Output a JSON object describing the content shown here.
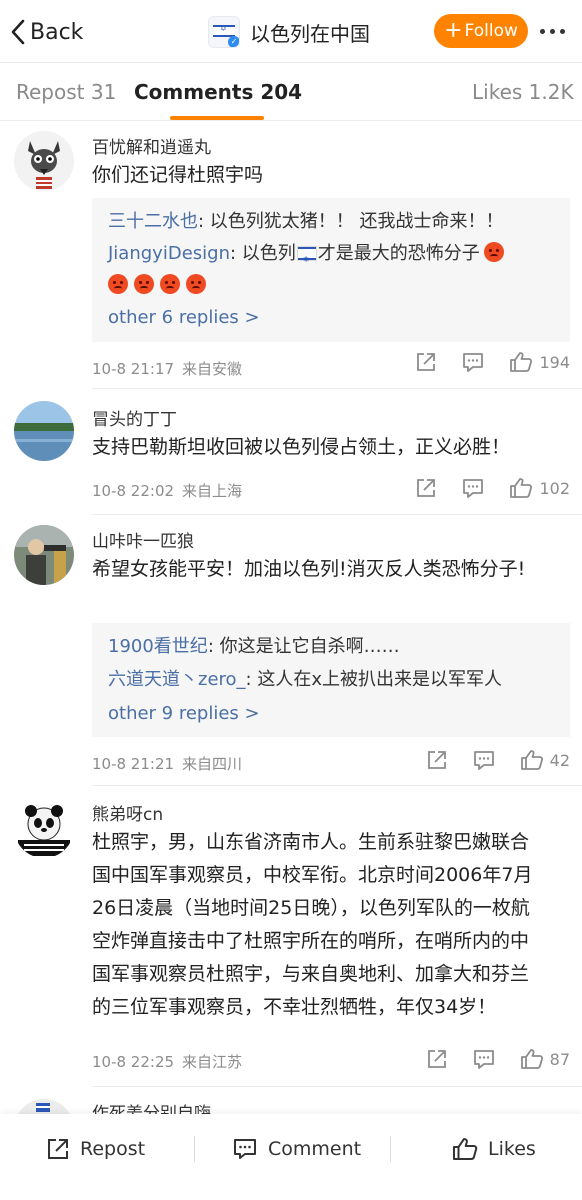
{
  "header": {
    "back_label": "Back",
    "title": "以色列在中国",
    "follow_label": "Follow",
    "follow_plus": "+",
    "accent_color": "#ff8200"
  },
  "tabs": {
    "repost": "Repost 31",
    "comments": "Comments 204",
    "likes": "Likes 1.2K"
  },
  "comments": [
    {
      "username": "百忧解和逍遥丸",
      "text": "你们还记得杜照宇吗",
      "replies": [
        {
          "name": "三十二水也",
          "text": ": 以色列犹太猪！！ 还我战士命来！！"
        },
        {
          "name": "JiangyiDesign",
          "text_before": ": 以色列",
          "text_after": "才是最大的恐怖分子"
        }
      ],
      "more_replies": "other 6 replies >",
      "time": "10-8 21:17",
      "location": "来自安徽",
      "likes": "194"
    },
    {
      "username": "冒头的丁丁",
      "text": "支持巴勒斯坦收回被以色列侵占领土，正义必胜！",
      "time": "10-8 22:02",
      "location": "来自上海",
      "likes": "102"
    },
    {
      "username": "山咔咔一匹狼",
      "text": "希望女孩能平安！加油以色列!消灭反人类恐怖分子!",
      "replies": [
        {
          "name": "1900看世纪",
          "text": ": 你这是让它自杀啊……"
        },
        {
          "name": "六道天道丶zero_",
          "text": ": 这人在x上被扒出来是以军军人"
        }
      ],
      "more_replies": "other 9 replies >",
      "time": "10-8 21:21",
      "location": "来自四川",
      "likes": "42"
    },
    {
      "username": "熊弟呀cn",
      "text": "杜照宇，男，山东省济南市人。生前系驻黎巴嫩联合国中国军事观察员，中校军衔。北京时间2006年7月26日凌晨（当地时间25日晚），以色列军队的一枚航空炸弹直接击中了杜照宇所在的哨所，在哨所内的中国军事观察员杜照宇，与来自奥地利、加拿大和芬兰的三位军事观察员，不幸壮烈牺牲，年仅34岁！",
      "time": "10-8 22:25",
      "location": "来自江苏",
      "likes": "87"
    },
    {
      "username": "作死姜分别自嗨"
    }
  ],
  "bottom_bar": {
    "repost": "Repost",
    "comment": "Comment",
    "likes": "Likes"
  },
  "colors": {
    "link": "#4a6fa5",
    "meta": "#8c8c8c",
    "reply_bg": "#f6f6f6"
  }
}
